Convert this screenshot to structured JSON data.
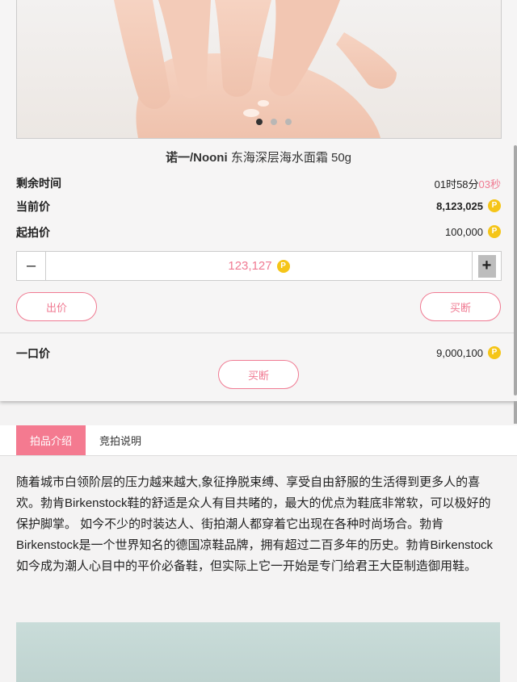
{
  "product": {
    "brand": "诺一/Nooni",
    "name": "东海深层海水面霜 50g"
  },
  "carousel": {
    "count": 3,
    "active_index": 0
  },
  "rows": {
    "remaining_label": "剩余时间",
    "remaining_time_main": "01时58分",
    "remaining_time_sec": "03秒",
    "current_label": "当前价",
    "current_value": "8,123,025",
    "start_label": "起拍价",
    "start_value": "100,000"
  },
  "coin_symbol": "P",
  "bid": {
    "minus_label": "–",
    "plus_label": "+",
    "value": "123,127"
  },
  "buttons": {
    "bid_label": "出价",
    "buyout_label": "买断",
    "buyout2_label": "买断"
  },
  "buy_now": {
    "label": "一口价",
    "value": "9,000,100"
  },
  "tabs": [
    {
      "label": "拍品介绍",
      "active": true
    },
    {
      "label": "竞拍说明",
      "active": false
    }
  ],
  "description": "随着城市白领阶层的压力越来越大,象征挣脱束缚、享受自由舒服的生活得到更多人的喜欢。勃肯Birkenstock鞋的舒适是众人有目共睹的，最大的优点为鞋底非常软，可以极好的保护脚掌。 如今不少的时装达人、街拍潮人都穿着它出现在各种时尚场合。勃肯Birkenstock是一个世界知名的德国凉鞋品牌，拥有超过二百多年的历史。勃肯Birkenstock如今成为潮人心目中的平价必备鞋，但实际上它一开始是专门给君王大臣制造御用鞋。",
  "colors": {
    "accent": "#f07a92",
    "coin": "#f5c518"
  }
}
